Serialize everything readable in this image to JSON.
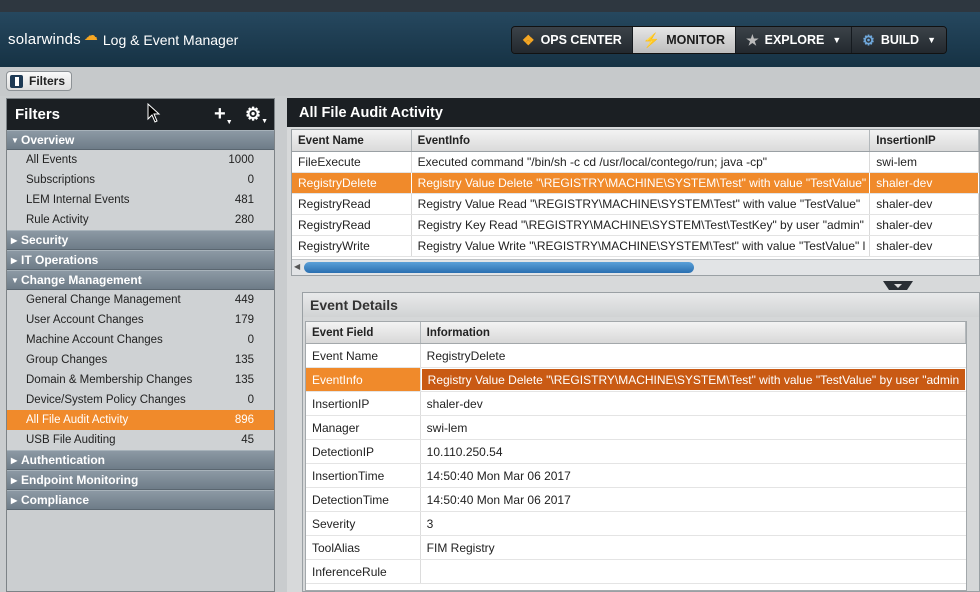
{
  "header": {
    "brand": "solarwinds",
    "product": "Log & Event Manager",
    "nav": [
      {
        "label": "OPS CENTER",
        "icon": "ops-center-icon",
        "active": false,
        "dropdown": false
      },
      {
        "label": "MONITOR",
        "icon": "lightning-icon",
        "active": true,
        "dropdown": false
      },
      {
        "label": "EXPLORE",
        "icon": "telescope-icon",
        "active": false,
        "dropdown": true
      },
      {
        "label": "BUILD",
        "icon": "gear-icon",
        "active": false,
        "dropdown": true
      }
    ]
  },
  "toolbar": {
    "filters_toggle": "Filters"
  },
  "filters": {
    "title": "Filters",
    "categories": [
      {
        "name": "Overview",
        "expanded": true,
        "items": [
          {
            "label": "All Events",
            "count": "1000"
          },
          {
            "label": "Subscriptions",
            "count": "0"
          },
          {
            "label": "LEM Internal Events",
            "count": "481"
          },
          {
            "label": "Rule Activity",
            "count": "280"
          }
        ]
      },
      {
        "name": "Security",
        "expanded": false,
        "items": []
      },
      {
        "name": "IT Operations",
        "expanded": false,
        "items": []
      },
      {
        "name": "Change Management",
        "expanded": true,
        "items": [
          {
            "label": "General Change Management",
            "count": "449"
          },
          {
            "label": "User Account Changes",
            "count": "179"
          },
          {
            "label": "Machine Account Changes",
            "count": "0"
          },
          {
            "label": "Group Changes",
            "count": "135"
          },
          {
            "label": "Domain & Membership Changes",
            "count": "135"
          },
          {
            "label": "Device/System Policy Changes",
            "count": "0"
          },
          {
            "label": "All File Audit Activity",
            "count": "896",
            "selected": true
          },
          {
            "label": "USB File Auditing",
            "count": "45"
          }
        ]
      },
      {
        "name": "Authentication",
        "expanded": false,
        "items": []
      },
      {
        "name": "Endpoint Monitoring",
        "expanded": false,
        "items": []
      },
      {
        "name": "Compliance",
        "expanded": false,
        "items": []
      }
    ]
  },
  "grid": {
    "title": "All File Audit Activity",
    "columns": [
      "Event Name",
      "EventInfo",
      "InsertionIP"
    ],
    "rows": [
      {
        "name": "FileExecute",
        "info": "Executed command \"/bin/sh -c cd /usr/local/contego/run; java -cp\"",
        "ip": "swi-lem"
      },
      {
        "name": "RegistryDelete",
        "info": "Registry Value Delete \"\\REGISTRY\\MACHINE\\SYSTEM\\Test\" with value \"TestValue\"",
        "ip": "shaler-dev",
        "selected": true
      },
      {
        "name": "RegistryRead",
        "info": "Registry Value Read \"\\REGISTRY\\MACHINE\\SYSTEM\\Test\" with value \"TestValue\"",
        "ip": "shaler-dev"
      },
      {
        "name": "RegistryRead",
        "info": "Registry Key Read \"\\REGISTRY\\MACHINE\\SYSTEM\\Test\\TestKey\" by user \"admin\"",
        "ip": "shaler-dev"
      },
      {
        "name": "RegistryWrite",
        "info": "Registry Value Write \"\\REGISTRY\\MACHINE\\SYSTEM\\Test\" with value \"TestValue\" l",
        "ip": "shaler-dev"
      }
    ]
  },
  "details": {
    "title": "Event Details",
    "columns": [
      "Event Field",
      "Information"
    ],
    "rows": [
      {
        "field": "Event Name",
        "value": "RegistryDelete"
      },
      {
        "field": "EventInfo",
        "value": "Registry Value Delete \"\\REGISTRY\\MACHINE\\SYSTEM\\Test\" with value \"TestValue\" by user \"admin",
        "selected": true
      },
      {
        "field": "InsertionIP",
        "value": "shaler-dev"
      },
      {
        "field": "Manager",
        "value": "swi-lem"
      },
      {
        "field": "DetectionIP",
        "value": "10.110.250.54"
      },
      {
        "field": "InsertionTime",
        "value": "14:50:40 Mon Mar 06 2017"
      },
      {
        "field": "DetectionTime",
        "value": "14:50:40 Mon Mar 06 2017"
      },
      {
        "field": "Severity",
        "value": "3"
      },
      {
        "field": "ToolAlias",
        "value": "FIM Registry"
      },
      {
        "field": "InferenceRule",
        "value": ""
      }
    ]
  },
  "colors": {
    "accent": "#f08a2b",
    "header_bg": "#163244",
    "panel_head": "#1b1f23"
  }
}
